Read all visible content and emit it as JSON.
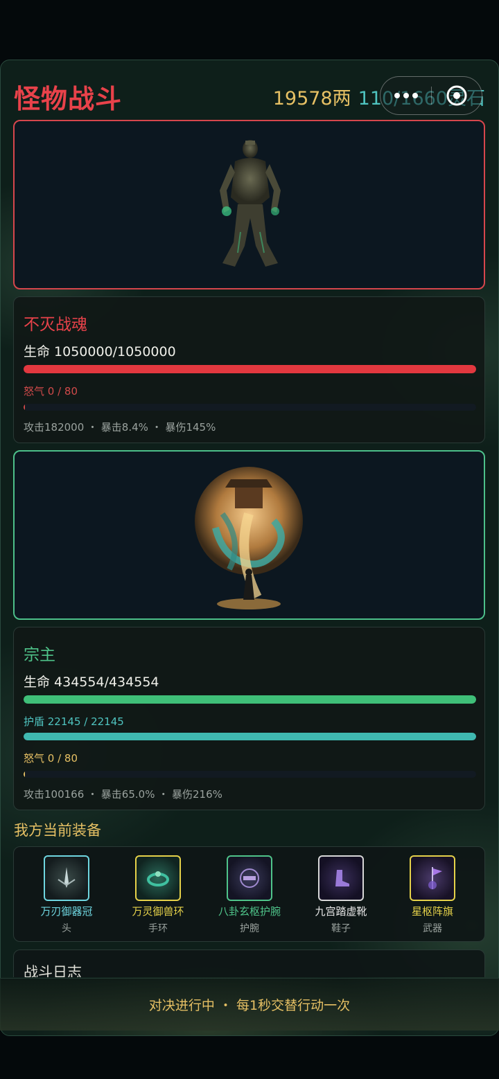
{
  "header": {
    "title": "怪物战斗",
    "gold": "19578两",
    "jade": "110/1660灵石"
  },
  "enemy": {
    "name": "不灭战魂",
    "hp_label": "生命 1050000/1050000",
    "hp_fraction": 1.0,
    "rage_label": "怒气 0 / 80",
    "rage_fraction": 0,
    "stats": "攻击182000 ・ 暴击8.4% ・ 暴伤145%"
  },
  "player": {
    "name": "宗主",
    "hp_label": "生命 434554/434554",
    "hp_fraction": 1.0,
    "shield_label": "护盾 22145 / 22145",
    "shield_fraction": 1.0,
    "rage_label": "怒气 0 / 80",
    "rage_fraction": 0,
    "stats": "攻击100166 ・ 暴击65.0% ・ 暴伤216%"
  },
  "equipment": {
    "title": "我方当前装备",
    "items": [
      {
        "name": "万刃御器冠",
        "slot": "头",
        "icon": "sword-crown-icon",
        "color": "#6fd6e0"
      },
      {
        "name": "万灵御兽环",
        "slot": "手环",
        "icon": "beast-ring-icon",
        "color": "#e6d24a"
      },
      {
        "name": "八卦玄枢护腕",
        "slot": "护腕",
        "icon": "bagua-bracer-icon",
        "color": "#4fc48a"
      },
      {
        "name": "九宫踏虚靴",
        "slot": "鞋子",
        "icon": "boots-icon",
        "color": "#e8e8e8"
      },
      {
        "name": "星枢阵旗",
        "slot": "武器",
        "icon": "banner-icon",
        "color": "#e6d24a"
      }
    ]
  },
  "log": {
    "title": "战斗日志"
  },
  "footer": {
    "status": "对决进行中 ・ 每1秒交替行动一次"
  },
  "colors": {
    "enemy": "#d7464c",
    "hp_enemy": "#e2383f",
    "hp_player": "#3fbf78",
    "shield": "#3fb8b0",
    "gold": "#e6c064"
  }
}
